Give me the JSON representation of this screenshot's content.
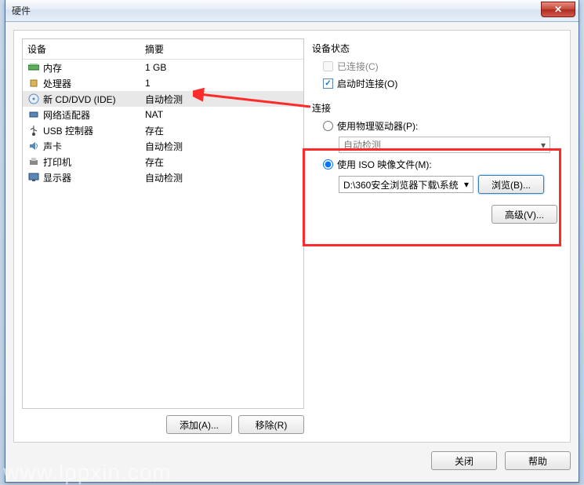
{
  "window": {
    "title": "硬件"
  },
  "table": {
    "header_device": "设备",
    "header_summary": "摘要",
    "rows": [
      {
        "name": "内存",
        "summary": "1 GB"
      },
      {
        "name": "处理器",
        "summary": "1"
      },
      {
        "name": "新 CD/DVD (IDE)",
        "summary": "自动检测",
        "selected": true
      },
      {
        "name": "网络适配器",
        "summary": "NAT"
      },
      {
        "name": "USB 控制器",
        "summary": "存在"
      },
      {
        "name": "声卡",
        "summary": "自动检测"
      },
      {
        "name": "打印机",
        "summary": "存在"
      },
      {
        "name": "显示器",
        "summary": "自动检测"
      }
    ]
  },
  "buttons": {
    "add": "添加(A)...",
    "remove": "移除(R)",
    "browse": "浏览(B)...",
    "advanced": "高级(V)...",
    "close": "关闭",
    "help": "帮助"
  },
  "status": {
    "title": "设备状态",
    "connected": "已连接(C)",
    "connect_on_power": "启动时连接(O)"
  },
  "connection": {
    "title": "连接",
    "physical": "使用物理驱动器(P):",
    "physical_value": "自动检测",
    "iso": "使用 ISO 映像文件(M):",
    "iso_value": "D:\\360安全浏览器下载\\系统"
  },
  "watermark": "www.lppxin.com"
}
